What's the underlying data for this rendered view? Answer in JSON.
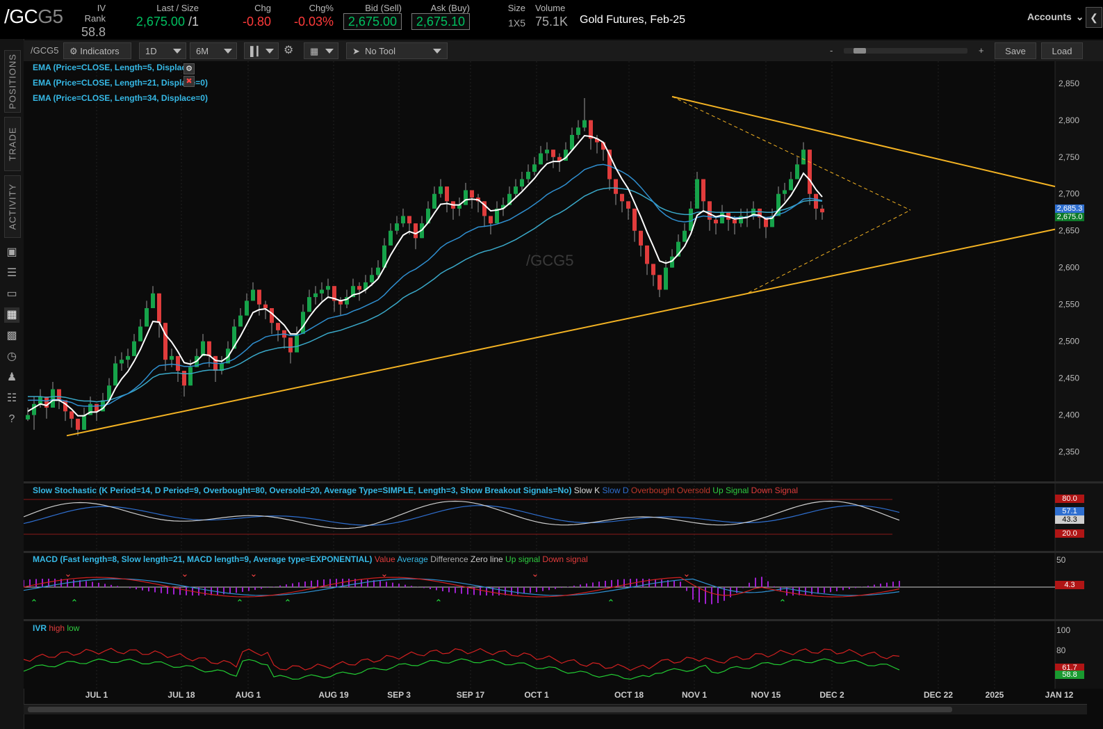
{
  "quote": {
    "symbol_main": "/GC",
    "symbol_suffix": "G5",
    "iv_rank_label": "IV Rank",
    "iv_rank": "58.8",
    "last_label": "Last / Size",
    "last": "2,675.00",
    "last_size": "/1",
    "chg_label": "Chg",
    "chg": "-0.80",
    "chgpct_label": "Chg%",
    "chgpct": "-0.03%",
    "bid_label": "Bid (Sell)",
    "bid": "2,675.00",
    "ask_label": "Ask (Buy)",
    "ask": "2,675.10",
    "size_label": "Size",
    "size": "1X5",
    "volume_label": "Volume",
    "volume": "75.1K",
    "description": "Gold Futures, Feb-25"
  },
  "accounts_label": "Accounts",
  "rail": {
    "tabs": [
      "POSITIONS",
      "TRADE",
      "ACTIVITY"
    ],
    "icons": [
      "monitor-icon",
      "list-icon",
      "tv-icon",
      "chart-icon",
      "grid-icon",
      "gauge-icon",
      "people-icon",
      "calendar-icon",
      "help-icon"
    ]
  },
  "toolbar": {
    "symbol": "/GCG5",
    "indicators": "Indicators",
    "period": "1D",
    "range": "6M",
    "drawing_tool": "No Tool",
    "zoom_minus": "-",
    "zoom_plus": "+",
    "save": "Save",
    "load": "Load"
  },
  "chart_data": {
    "type": "candlestick",
    "symbol_watermark": "/GCG5",
    "studies": [
      "EMA (Price=CLOSE, Length=5, Displace=0)",
      "EMA (Price=CLOSE, Length=21, Displace=0)",
      "EMA (Price=CLOSE, Length=34, Displace=0)"
    ],
    "price_axis": [
      "2,850",
      "2,800",
      "2,750",
      "2,700",
      "2,650",
      "2,600",
      "2,550",
      "2,500",
      "2,450",
      "2,400",
      "2,350"
    ],
    "price_range": [
      2310,
      2880
    ],
    "price_tags": {
      "ema_tag": "2,685.3",
      "last_tag": "2,675.0"
    },
    "x_axis": [
      "JUL 1",
      "JUL 18",
      "AUG 1",
      "AUG 19",
      "SEP 3",
      "SEP 17",
      "OCT 1",
      "OCT 18",
      "NOV 1",
      "NOV 15",
      "DEC 2",
      "DEC 22",
      "2025",
      "JAN 12"
    ],
    "closes": [
      2400,
      2415,
      2425,
      2410,
      2435,
      2420,
      2405,
      2395,
      2380,
      2400,
      2415,
      2405,
      2420,
      2440,
      2470,
      2475,
      2480,
      2500,
      2520,
      2545,
      2565,
      2525,
      2475,
      2480,
      2460,
      2440,
      2465,
      2480,
      2500,
      2480,
      2460,
      2470,
      2490,
      2520,
      2535,
      2555,
      2570,
      2550,
      2545,
      2525,
      2515,
      2505,
      2485,
      2510,
      2540,
      2560,
      2565,
      2570,
      2575,
      2555,
      2550,
      2560,
      2575,
      2570,
      2580,
      2590,
      2600,
      2630,
      2650,
      2660,
      2670,
      2660,
      2640,
      2660,
      2680,
      2700,
      2710,
      2690,
      2680,
      2685,
      2705,
      2695,
      2690,
      2670,
      2660,
      2680,
      2685,
      2700,
      2710,
      2720,
      2730,
      2740,
      2755,
      2760,
      2750,
      2745,
      2760,
      2780,
      2790,
      2800,
      2775,
      2770,
      2760,
      2720,
      2700,
      2690,
      2680,
      2650,
      2630,
      2605,
      2590,
      2570,
      2600,
      2615,
      2635,
      2650,
      2680,
      2720,
      2690,
      2665,
      2660,
      2675,
      2665,
      2660,
      2670,
      2670,
      2680,
      2668,
      2655,
      2670,
      2700,
      2705,
      2720,
      2740,
      2760,
      2700,
      2680,
      2675
    ],
    "lows": [
      2392,
      2380,
      2410,
      2395,
      2420,
      2408,
      2392,
      2383,
      2372,
      2386,
      2400,
      2392,
      2405,
      2425,
      2455,
      2460,
      2464,
      2485,
      2505,
      2530,
      2550,
      2505,
      2460,
      2465,
      2445,
      2425,
      2450,
      2465,
      2485,
      2465,
      2445,
      2455,
      2474,
      2505,
      2520,
      2540,
      2555,
      2535,
      2530,
      2510,
      2500,
      2490,
      2470,
      2494,
      2525,
      2545,
      2550,
      2555,
      2560,
      2540,
      2535,
      2545,
      2560,
      2555,
      2565,
      2575,
      2585,
      2615,
      2635,
      2645,
      2655,
      2645,
      2625,
      2645,
      2665,
      2685,
      2695,
      2675,
      2665,
      2670,
      2690,
      2680,
      2675,
      2655,
      2645,
      2665,
      2670,
      2685,
      2695,
      2705,
      2715,
      2725,
      2740,
      2745,
      2735,
      2730,
      2745,
      2765,
      2775,
      2785,
      2760,
      2755,
      2745,
      2705,
      2685,
      2675,
      2665,
      2635,
      2615,
      2590,
      2575,
      2560,
      2585,
      2600,
      2620,
      2635,
      2665,
      2705,
      2675,
      2650,
      2645,
      2660,
      2650,
      2645,
      2655,
      2655,
      2665,
      2653,
      2640,
      2655,
      2685,
      2690,
      2705,
      2725,
      2745,
      2685,
      2665,
      2665
    ],
    "highs": [
      2410,
      2425,
      2435,
      2420,
      2445,
      2430,
      2415,
      2405,
      2390,
      2410,
      2425,
      2415,
      2430,
      2450,
      2480,
      2485,
      2490,
      2510,
      2530,
      2555,
      2575,
      2535,
      2485,
      2490,
      2470,
      2450,
      2475,
      2490,
      2510,
      2490,
      2470,
      2480,
      2500,
      2530,
      2545,
      2565,
      2580,
      2560,
      2555,
      2535,
      2525,
      2515,
      2495,
      2520,
      2550,
      2570,
      2575,
      2580,
      2585,
      2565,
      2560,
      2570,
      2585,
      2580,
      2590,
      2600,
      2610,
      2640,
      2660,
      2670,
      2680,
      2670,
      2650,
      2670,
      2690,
      2710,
      2720,
      2700,
      2690,
      2695,
      2715,
      2705,
      2700,
      2680,
      2670,
      2690,
      2695,
      2710,
      2720,
      2730,
      2740,
      2750,
      2765,
      2770,
      2760,
      2755,
      2770,
      2790,
      2800,
      2830,
      2785,
      2780,
      2770,
      2730,
      2710,
      2700,
      2690,
      2660,
      2640,
      2615,
      2600,
      2580,
      2610,
      2625,
      2645,
      2660,
      2690,
      2730,
      2700,
      2675,
      2670,
      2685,
      2675,
      2670,
      2680,
      2680,
      2690,
      2678,
      2665,
      2680,
      2710,
      2715,
      2730,
      2750,
      2770,
      2760,
      2700,
      2685
    ],
    "ema5": [
      2405,
      2410,
      2415,
      2413,
      2420,
      2420,
      2415,
      2408,
      2399,
      2399,
      2404,
      2404,
      2409,
      2419,
      2436,
      2449,
      2459,
      2473,
      2489,
      2508,
      2527,
      2526,
      2509,
      2499,
      2486,
      2471,
      2469,
      2473,
      2482,
      2481,
      2474,
      2473,
      2479,
      2493,
      2507,
      2523,
      2539,
      2543,
      2544,
      2538,
      2530,
      2522,
      2510,
      2510,
      2520,
      2533,
      2544,
      2553,
      2560,
      2558,
      2555,
      2557,
      2563,
      2565,
      2570,
      2577,
      2585,
      2600,
      2617,
      2631,
      2644,
      2649,
      2646,
      2651,
      2661,
      2674,
      2686,
      2687,
      2685,
      2685,
      2692,
      2693,
      2692,
      2685,
      2677,
      2678,
      2680,
      2687,
      2695,
      2703,
      2712,
      2721,
      2732,
      2741,
      2744,
      2744,
      2749,
      2759,
      2769,
      2779,
      2778,
      2775,
      2770,
      2753,
      2735,
      2720,
      2707,
      2688,
      2669,
      2648,
      2629,
      2609,
      2606,
      2609,
      2618,
      2629,
      2646,
      2671,
      2677,
      2673,
      2669,
      2671,
      2669,
      2666,
      2667,
      2668,
      2672,
      2671,
      2666,
      2667,
      2678,
      2687,
      2698,
      2712,
      2728,
      2719,
      2706,
      2696
    ],
    "ema21": [
      2420,
      2420,
      2420,
      2419,
      2421,
      2421,
      2419,
      2417,
      2413,
      2412,
      2412,
      2412,
      2413,
      2415,
      2420,
      2425,
      2429,
      2435,
      2442,
      2451,
      2461,
      2467,
      2468,
      2469,
      2468,
      2466,
      2466,
      2467,
      2470,
      2471,
      2470,
      2470,
      2472,
      2476,
      2482,
      2489,
      2497,
      2501,
      2506,
      2508,
      2509,
      2510,
      2508,
      2508,
      2511,
      2516,
      2521,
      2526,
      2531,
      2533,
      2535,
      2537,
      2541,
      2544,
      2548,
      2552,
      2556,
      2563,
      2572,
      2580,
      2588,
      2594,
      2598,
      2604,
      2610,
      2618,
      2627,
      2633,
      2637,
      2641,
      2647,
      2651,
      2655,
      2656,
      2657,
      2659,
      2662,
      2665,
      2670,
      2675,
      2680,
      2686,
      2692,
      2699,
      2704,
      2708,
      2713,
      2720,
      2726,
      2733,
      2736,
      2739,
      2740,
      2738,
      2734,
      2730,
      2725,
      2718,
      2709,
      2699,
      2689,
      2678,
      2671,
      2666,
      2663,
      2662,
      2663,
      2668,
      2670,
      2669,
      2668,
      2669,
      2669,
      2668,
      2668,
      2669,
      2670,
      2670,
      2668,
      2669,
      2672,
      2675,
      2680,
      2686,
      2693,
      2694,
      2693,
      2691
    ],
    "ema34": [
      2425,
      2425,
      2425,
      2424,
      2425,
      2425,
      2424,
      2422,
      2420,
      2419,
      2419,
      2418,
      2419,
      2420,
      2423,
      2426,
      2429,
      2433,
      2438,
      2444,
      2451,
      2455,
      2456,
      2457,
      2457,
      2456,
      2456,
      2458,
      2460,
      2461,
      2461,
      2461,
      2463,
      2466,
      2470,
      2475,
      2480,
      2484,
      2487,
      2489,
      2491,
      2492,
      2492,
      2493,
      2496,
      2499,
      2503,
      2507,
      2511,
      2513,
      2515,
      2518,
      2521,
      2524,
      2527,
      2531,
      2535,
      2540,
      2546,
      2552,
      2559,
      2564,
      2568,
      2573,
      2579,
      2585,
      2592,
      2597,
      2601,
      2606,
      2611,
      2615,
      2619,
      2622,
      2624,
      2627,
      2630,
      2634,
      2638,
      2643,
      2648,
      2653,
      2659,
      2665,
      2670,
      2674,
      2679,
      2685,
      2691,
      2697,
      2701,
      2705,
      2707,
      2708,
      2708,
      2707,
      2706,
      2703,
      2699,
      2694,
      2689,
      2682,
      2678,
      2675,
      2673,
      2672,
      2672,
      2675,
      2676,
      2676,
      2675,
      2675,
      2675,
      2675,
      2675,
      2675,
      2676,
      2676,
      2675,
      2675,
      2677,
      2679,
      2682,
      2686,
      2690,
      2691,
      2691,
      2690
    ],
    "trendlines": {
      "support": {
        "from": [
          "JUN 24",
          2372
        ],
        "to": [
          "JAN 15",
          2652
        ]
      },
      "resistance": {
        "from": [
          "OCT 30",
          2832
        ],
        "to": [
          "JAN 15",
          2710
        ]
      }
    },
    "lower_studies": {
      "stochastic": {
        "title": "Slow Stochastic (K Period=14, D Period=9, Overbought=80, Oversold=20, Average Type=SIMPLE, Length=3, Show Breakout Signals=No)",
        "legend": [
          "Slow K",
          "Slow D",
          "Overbought",
          "Oversold",
          "Up Signal",
          "Down Signal"
        ],
        "levels": {
          "overbought": "80.0",
          "k": "57.1",
          "d": "43.3",
          "oversold": "20.0"
        }
      },
      "macd": {
        "title": "MACD (Fast length=8, Slow length=21, MACD length=9, Average type=EXPONENTIAL)",
        "legend": [
          "Value",
          "Average",
          "Difference",
          "Zero line",
          "Up signal",
          "Down signal"
        ],
        "axis_top": "50",
        "value_tag": "4.3"
      },
      "ivr": {
        "title": "IVR",
        "legend": [
          "high",
          "low"
        ],
        "axis": [
          "100",
          "80"
        ],
        "tags": [
          "61.7",
          "58.8"
        ]
      }
    }
  },
  "colors": {
    "up": "#16a34a",
    "down": "#e03c3c",
    "ema5": "#ffffff",
    "ema21": "#2f8fd0",
    "ema34": "#3aa9c9",
    "trend": "#f4b323",
    "accent": "#36b9e6"
  }
}
